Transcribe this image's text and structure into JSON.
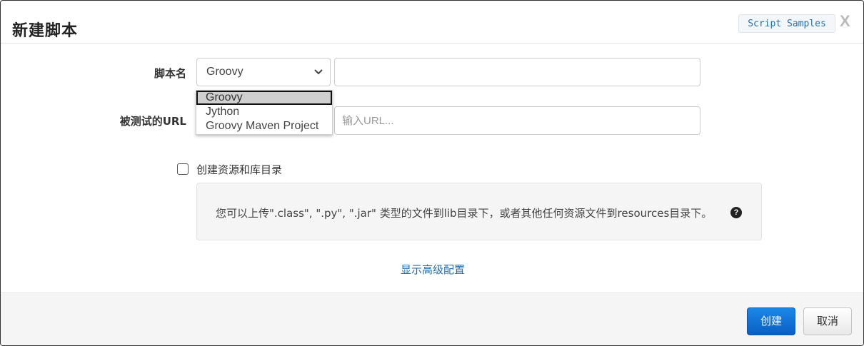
{
  "dialog": {
    "title": "新建脚本",
    "samples_button": "Script Samples",
    "close_label": "X"
  },
  "form": {
    "script_name_label": "脚本名",
    "language_select": {
      "selected": "Groovy",
      "options": [
        "Groovy",
        "Jython",
        "Groovy Maven Project"
      ]
    },
    "script_name_value": "",
    "url_label": "被测试的URL",
    "url_placeholder": "输入URL...",
    "url_value": "",
    "create_resources_label": "创建资源和库目录",
    "create_resources_checked": false,
    "info_text": "您可以上传\".class\", \".py\", \".jar\" 类型的文件到lib目录下，或者其他任何资源文件到resources目录下。",
    "help_icon": "question-circle-icon",
    "advanced_link": "显示高级配置"
  },
  "footer": {
    "create_button": "创建",
    "cancel_button": "取消"
  },
  "colors": {
    "primary": "#0a5fc4",
    "link": "#1f6fb2"
  }
}
